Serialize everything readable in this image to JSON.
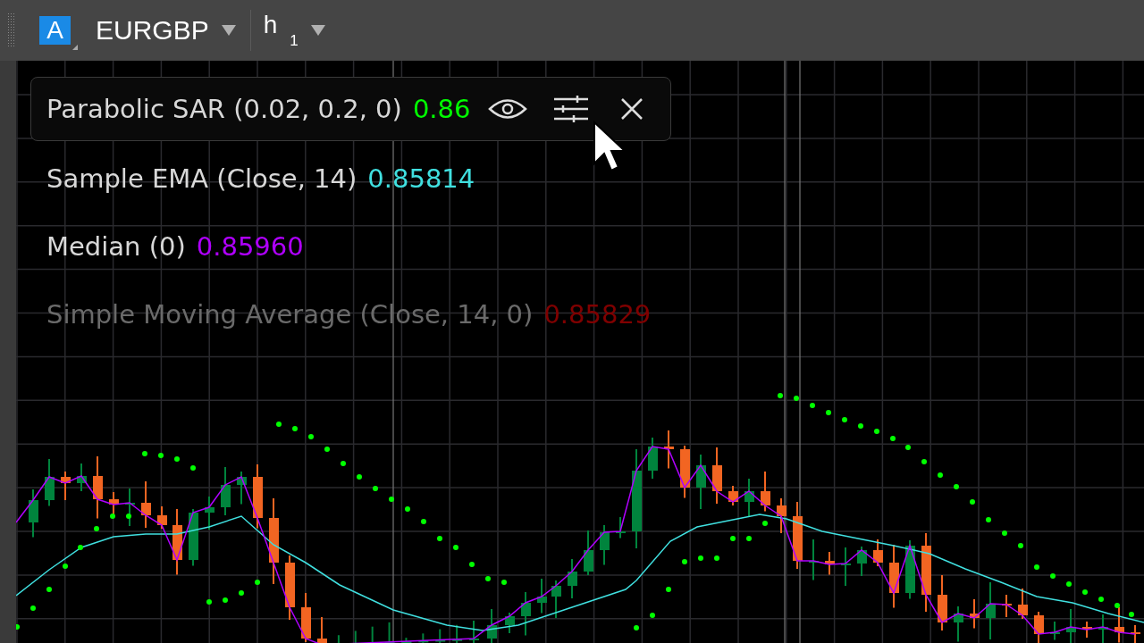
{
  "toolbar": {
    "symbol_badge": "A",
    "symbol": "EURGBP",
    "timeframe": "h",
    "timeframe_sub": "1"
  },
  "legend": [
    {
      "name": "Parabolic SAR (0.02, 0.2, 0)",
      "value": "0.86",
      "color": "#00ff00",
      "hovered": true,
      "hidden": false
    },
    {
      "name": "Sample EMA (Close, 14)",
      "value": "0.85814",
      "color": "#40e0e0",
      "hovered": false,
      "hidden": false
    },
    {
      "name": "Median (0)",
      "value": "0.85960",
      "color": "#b000ff",
      "hovered": false,
      "hidden": false
    },
    {
      "name": "Simple Moving Average (Close, 14, 0)",
      "value": "0.85829",
      "color": "#800000",
      "hovered": false,
      "hidden": true
    }
  ]
}
